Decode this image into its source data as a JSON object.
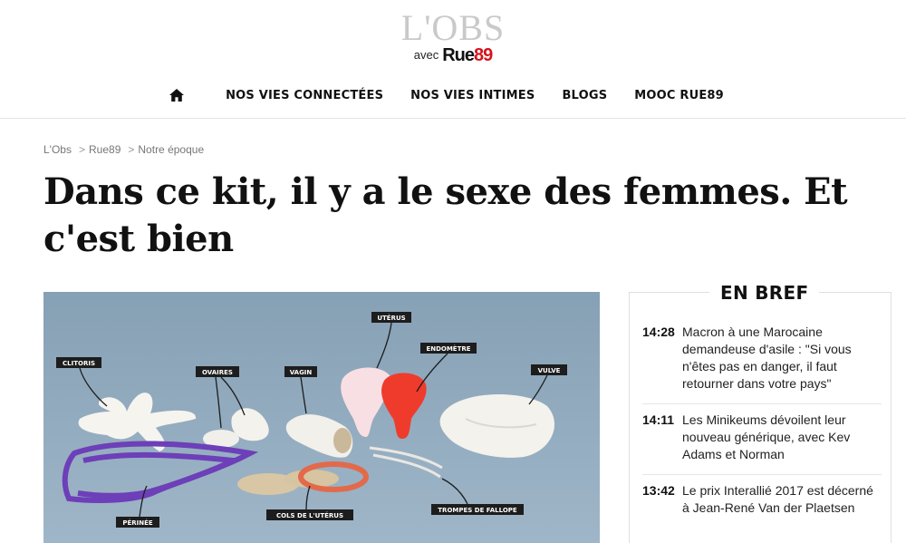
{
  "header": {
    "logo_main": "L'OBS",
    "logo_avec": "avec",
    "logo_rue": "Rue",
    "logo_rue_num": "89"
  },
  "nav": {
    "home_icon": "home-icon",
    "items": [
      {
        "label": "NOS VIES CONNECTÉES"
      },
      {
        "label": "NOS VIES INTIMES"
      },
      {
        "label": "BLOGS"
      },
      {
        "label": "MOOC RUE89"
      }
    ]
  },
  "breadcrumb": [
    {
      "label": "L'Obs"
    },
    {
      "label": "Rue89"
    },
    {
      "label": "Notre époque"
    }
  ],
  "breadcrumb_separator": ">",
  "article": {
    "title": "Dans ce kit, il y a le sexe des femmes. Et c'est bien"
  },
  "figure": {
    "labels": {
      "clitoris": "CLITORIS",
      "ovaires": "OVAIRES",
      "vagin": "VAGIN",
      "uterus": "UTÉRUS",
      "endometre": "ENDOMÈTRE",
      "vulve": "VULVE",
      "perinee": "PÉRINÉE",
      "cols": "COLS DE L'UTÉRUS",
      "trompes": "TROMPES DE FALLOPE"
    }
  },
  "en_bref": {
    "title": "EN BREF",
    "items": [
      {
        "time": "14:28",
        "text": "Macron à une Marocaine demandeuse d'asile : \"Si vous n'êtes pas en danger, il faut retourner dans votre pays\""
      },
      {
        "time": "14:11",
        "text": "Les Minikeums dévoilent leur nouveau générique, avec Kev Adams et Norman"
      },
      {
        "time": "13:42",
        "text": "Le prix Interallié 2017 est décerné à Jean-René Van der Plaetsen"
      }
    ]
  },
  "colors": {
    "brand_red": "#d4131b",
    "figure_background": "#8fa9bd"
  }
}
